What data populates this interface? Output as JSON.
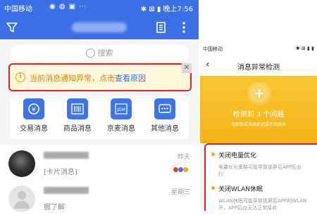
{
  "left_screen": {
    "status_bar": {
      "carrier": "中国移动",
      "time": "晚上7:56"
    },
    "header": {
      "title_redacted": true
    },
    "search": {
      "placeholder": "搜索"
    },
    "notice": {
      "text": "当前消息通知异常，点击",
      "link": "查看原因",
      "close": "✕"
    },
    "categories": [
      {
        "label": "交易消息",
        "icon": "transaction-icon"
      },
      {
        "label": "商品消息",
        "icon": "barcode-icon"
      },
      {
        "label": "京麦消息",
        "icon": "jdm-icon",
        "icon_text": "JDM"
      },
      {
        "label": "其他消息",
        "icon": "chat-dots-icon"
      }
    ],
    "messages": [
      {
        "preview": "[卡片消息]",
        "time": "昨天"
      },
      {
        "preview": "握了解",
        "time": "星期三"
      }
    ],
    "colors": {
      "primary": "#3a6fe6",
      "notice_bg": "#fff7dc",
      "highlight": "#e02424"
    }
  },
  "right_screen": {
    "status_bar": {
      "carrier": "中国移动"
    },
    "nav": {
      "back": "‹",
      "title": "消息异常检测"
    },
    "banner": {
      "count_text": "检测到 3 个问题",
      "subtext": "可能造成消息延迟或不到消息"
    },
    "issues": [
      {
        "title": "关闭电量优化",
        "desc": "电量优化策略可能导致锁屏后APP后台",
        "desc2": "行"
      },
      {
        "title": "关闭WLAN休眠",
        "desc": "WLAN休眠可能导致锁屏后APP的WLAN",
        "desc2": "开，APP后台无法正常接收"
      }
    ],
    "colors": {
      "banner": "#f5b41a",
      "bullet": "#f5a623"
    }
  }
}
